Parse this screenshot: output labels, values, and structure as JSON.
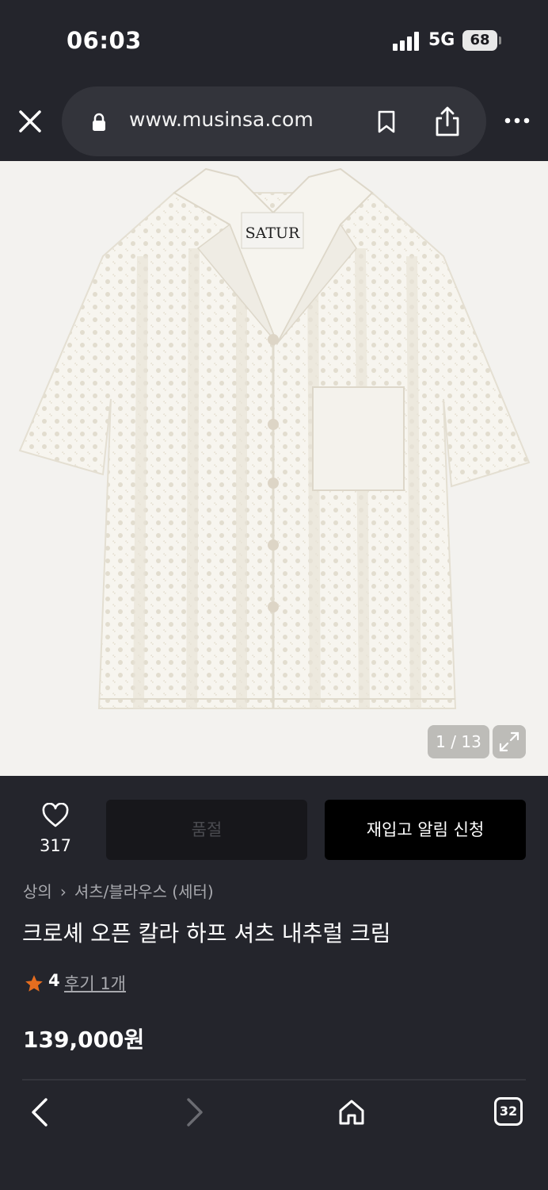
{
  "status_bar": {
    "time": "06:03",
    "network": "5G",
    "battery": "68"
  },
  "browser": {
    "url": "www.musinsa.com",
    "icons": [
      "close-icon",
      "lock-icon",
      "bookmark-icon",
      "share-icon",
      "more-icon"
    ]
  },
  "product_image": {
    "brand_label": "SATUR",
    "counter": "1 / 13",
    "icons": [
      "expand-icon"
    ]
  },
  "actions": {
    "like_count": "317",
    "soldout_label": "품절",
    "restock_label": "재입고 알림 신청"
  },
  "product": {
    "breadcrumb": [
      "상의",
      "셔츠/블라우스 (세터)"
    ],
    "title": "크로셰 오픈 칼라 하프 셔츠 내추럴 크림",
    "rating": "4",
    "review_link": "후기 1개",
    "price": "139,000원"
  },
  "toolbar": {
    "tab_count": "32",
    "icons": [
      "back-icon",
      "forward-icon",
      "home-icon",
      "tabs-icon"
    ]
  },
  "colors": {
    "background": "#24252c",
    "restock_button": "#000000",
    "soldout_button": "#17171b",
    "star": "#e56d1f"
  }
}
